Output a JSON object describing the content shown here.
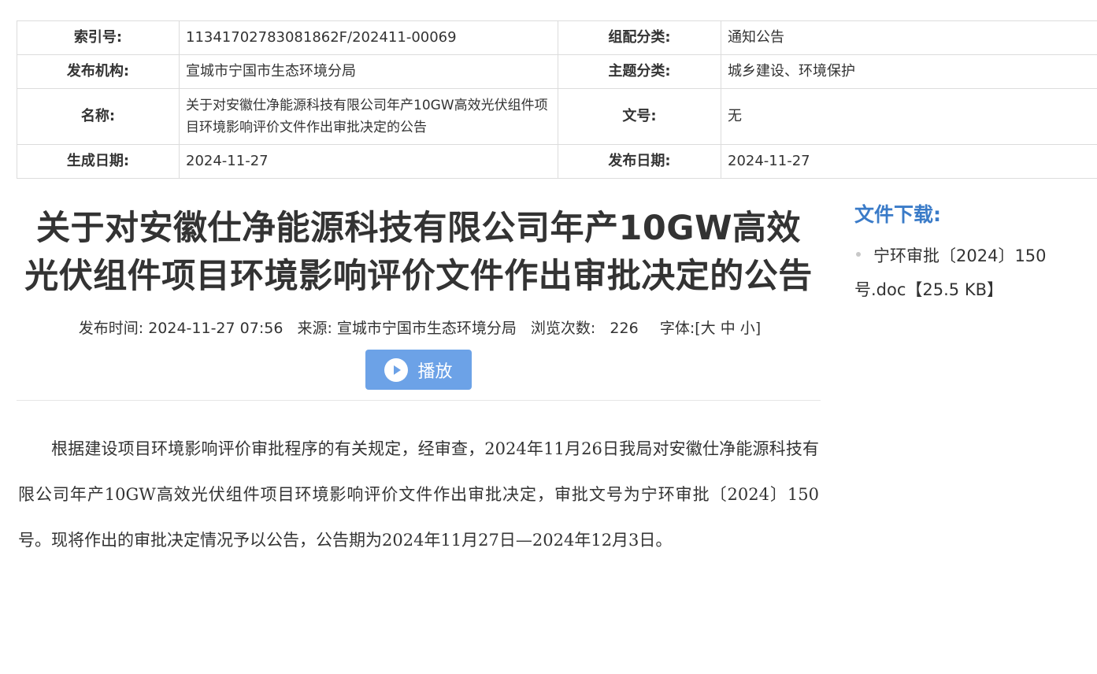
{
  "meta": {
    "index_no": {
      "label": "索引号:",
      "value": "11341702783081862F/202411-00069"
    },
    "category": {
      "label": "组配分类:",
      "value": "通知公告"
    },
    "publisher": {
      "label": "发布机构:",
      "value": "宣城市宁国市生态环境分局"
    },
    "subject": {
      "label": "主题分类:",
      "value": "城乡建设、环境保护"
    },
    "name": {
      "label": "名称:",
      "value": "关于对安徽仕净能源科技有限公司年产10GW高效光伏组件项目环境影响评价文件作出审批决定的公告"
    },
    "doc_no": {
      "label": "文号:",
      "value": "无"
    },
    "created": {
      "label": "生成日期:",
      "value": "2024-11-27"
    },
    "published": {
      "label": "发布日期:",
      "value": "2024-11-27"
    }
  },
  "article": {
    "title": "关于对安徽仕净能源科技有限公司年产10GW高效光伏组件项目环境影响评价文件作出审批决定的公告",
    "info": {
      "time_label": "发布时间:",
      "time_value": "2024-11-27 07:56",
      "source_label": "来源:",
      "source_value": "宣城市宁国市生态环境分局",
      "views_label": "浏览次数:",
      "views_value": "226",
      "font_label": "字体:",
      "font_open": "[",
      "font_large": "大",
      "font_medium": "中",
      "font_small": "小",
      "font_close": "]"
    },
    "play_label": "播放",
    "body": "根据建设项目环境影响评价审批程序的有关规定，经审查，2024年11月26日我局对安徽仕净能源科技有限公司年产10GW高效光伏组件项目环境影响评价文件作出审批决定，审批文号为宁环审批〔2024〕150号。现将作出的审批决定情况予以公告，公告期为2024年11月27日—2024年12月3日。"
  },
  "download": {
    "title": "文件下载:",
    "items": [
      {
        "name": "宁环审批〔2024〕150号.doc",
        "size": "【25.5 KB】"
      }
    ]
  },
  "colors": {
    "accent_blue": "#3a7bc8",
    "play_button": "#6ca2e7",
    "border": "#dcdcdc"
  },
  "icons": {
    "play": "play-circle-icon",
    "bullet": "bullet-dot-icon"
  }
}
